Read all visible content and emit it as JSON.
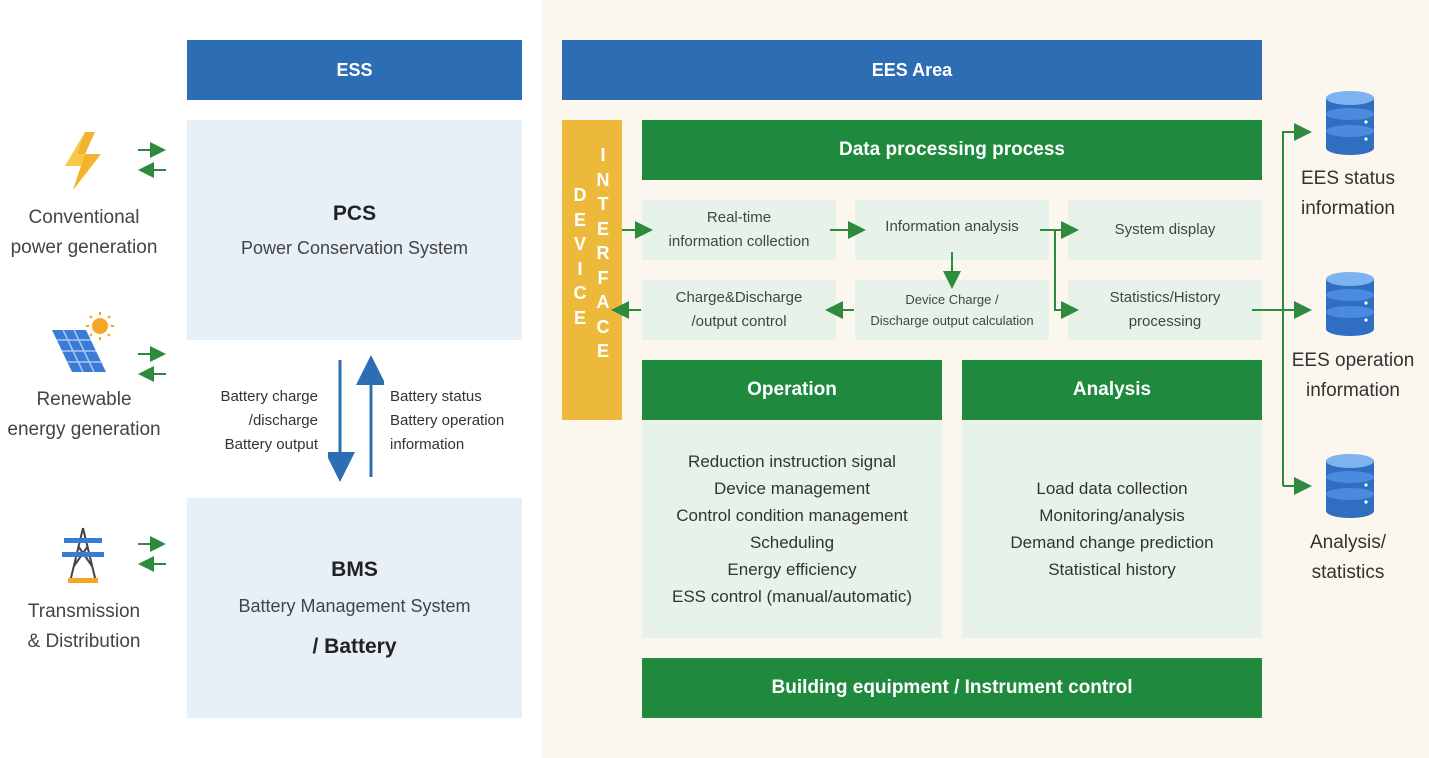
{
  "left": {
    "sources": [
      {
        "label_line1": "Conventional",
        "label_line2": "power generation",
        "icon": "lightning-icon"
      },
      {
        "label_line1": "Renewable",
        "label_line2": "energy generation",
        "icon": "solar-panel-icon"
      },
      {
        "label_line1": "Transmission",
        "label_line2": "& Distribution",
        "icon": "transmission-tower-icon"
      }
    ]
  },
  "ess": {
    "header": "ESS",
    "pcs": {
      "title": "PCS",
      "subtitle": "Power Conservation System"
    },
    "down_text": [
      "Battery charge",
      "/discharge",
      "Battery output"
    ],
    "up_text": [
      "Battery status",
      "Battery operation",
      "information"
    ],
    "bms": {
      "title": "BMS",
      "subtitle": "Battery Management System",
      "extra": "/ Battery"
    }
  },
  "ees": {
    "header": "EES Area",
    "device_interface": {
      "col1": [
        "D",
        "E",
        "V",
        "I",
        "C",
        "E"
      ],
      "col2": [
        "I",
        "N",
        "T",
        "E",
        "R",
        "F",
        "A",
        "C",
        "E"
      ]
    },
    "data_processing": {
      "title": "Data processing process",
      "realtime": [
        "Real-time",
        "information collection"
      ],
      "info_analysis": "Information analysis",
      "system_display": "System display",
      "charge_discharge": [
        "Charge&Discharge",
        "/output control"
      ],
      "device_charge": [
        "Device Charge /",
        "Discharge output calculation"
      ],
      "statistics": [
        "Statistics/History",
        "processing"
      ]
    },
    "operation": {
      "title": "Operation",
      "items": [
        "Reduction instruction signal",
        "Device management",
        "Control condition management",
        "Scheduling",
        "Energy efficiency",
        "ESS control (manual/automatic)"
      ]
    },
    "analysis": {
      "title": "Analysis",
      "items": [
        "Load data collection",
        "Monitoring/analysis",
        "Demand change prediction",
        "Statistical history"
      ]
    },
    "building": "Building equipment / Instrument control"
  },
  "databases": [
    {
      "line1": "EES status",
      "line2": "information"
    },
    {
      "line1": "EES operation",
      "line2": "information"
    },
    {
      "line1": "Analysis/",
      "line2": "statistics"
    }
  ],
  "colors": {
    "blue": "#2c6db4",
    "green": "#1f8a3e",
    "yellow": "#ecb93a",
    "arrow_green": "#2e8b3e",
    "arrow_blue": "#2c6db4"
  }
}
